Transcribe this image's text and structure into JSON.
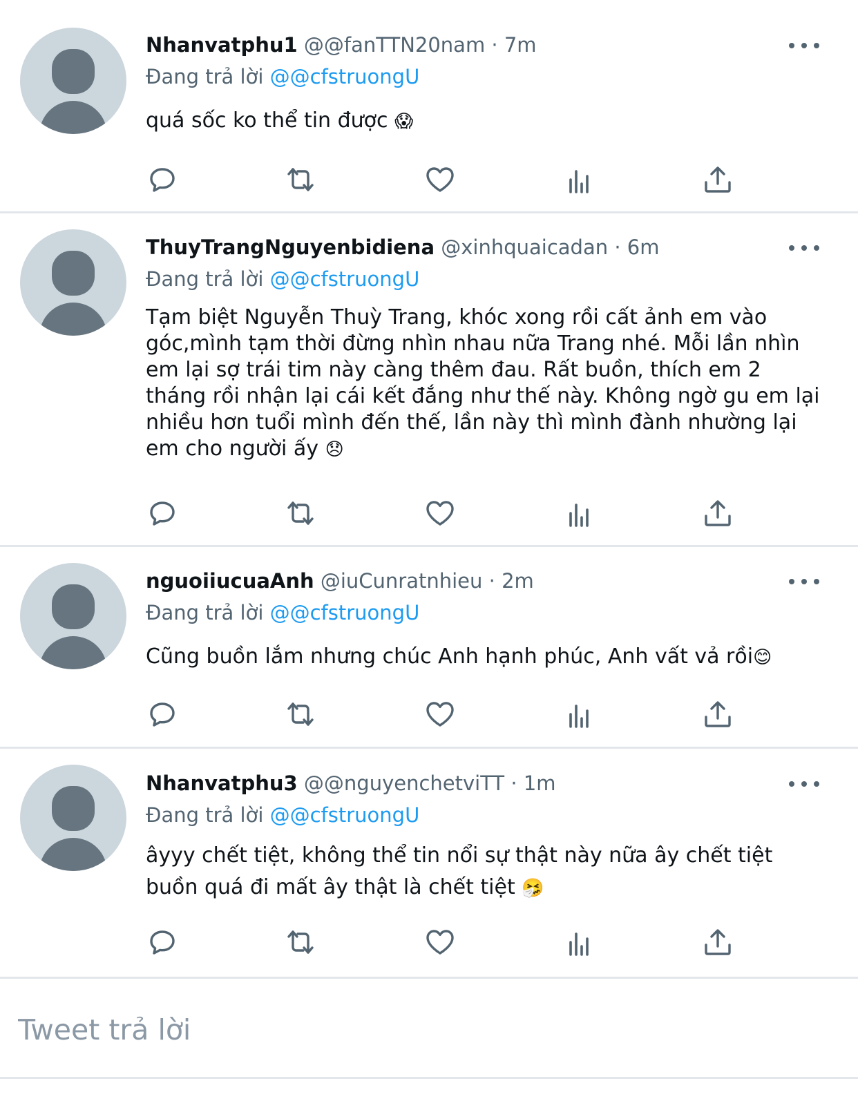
{
  "tweets": [
    {
      "name": "Nhanvatphu1",
      "handle": "@@fanTTN20nam",
      "time": "7m",
      "reply_prefix": "Đang trả lời",
      "reply_to": "@@cfstruongU",
      "text": "quá sốc ko thể tin được",
      "emoji": "😱"
    },
    {
      "name": "ThuyTrangNguyenbidiena",
      "handle": "@xinhquaicadan",
      "time": "6m",
      "reply_prefix": "Đang trả lời",
      "reply_to": "@@cfstruongU",
      "text": "Tạm biệt Nguyễn Thuỳ Trang, khóc xong rồi cất ảnh em vào góc,mình tạm thời đừng nhìn nhau nữa Trang nhé. Mỗi lần nhìn em lại sợ trái tim này càng thêm đau. Rất buồn, thích em 2 tháng rồi nhận lại cái kết đắng như thế này. Không ngờ gu em lại nhiều hơn tuổi mình đến thế, lần này thì mình đành nhường lại em cho người ấy",
      "emoji": "😞"
    },
    {
      "name": "nguoiiucuaAnh",
      "handle": "@iuCunratnhieu",
      "time": "2m",
      "reply_prefix": "Đang trả lời",
      "reply_to": "@@cfstruongU",
      "text": "Cũng buồn lắm nhưng chúc Anh hạnh phúc, Anh vất vả rồi",
      "emoji": "😊"
    },
    {
      "name": "Nhanvatphu3",
      "handle": "@@nguyenchetviTT",
      "time": "1m",
      "reply_prefix": "Đang trả lời",
      "reply_to": "@@cfstruongU",
      "text": "âyyy chết tiệt, không thể tin nổi sự thật này nữa ây chết tiệt buồn quá đi mất ây thật là chết tiệt",
      "emoji": "🤧"
    }
  ],
  "action_icons": [
    "reply-icon",
    "retweet-icon",
    "like-icon",
    "analytics-icon",
    "share-icon"
  ],
  "reply_box": {
    "placeholder": "Tweet trả lời"
  },
  "colors": {
    "mention": "#1d9bf0",
    "secondary_text": "#536471",
    "divider": "#e3e6ea",
    "avatar_bg": "#ccd6dd",
    "avatar_fg": "#66757f"
  }
}
